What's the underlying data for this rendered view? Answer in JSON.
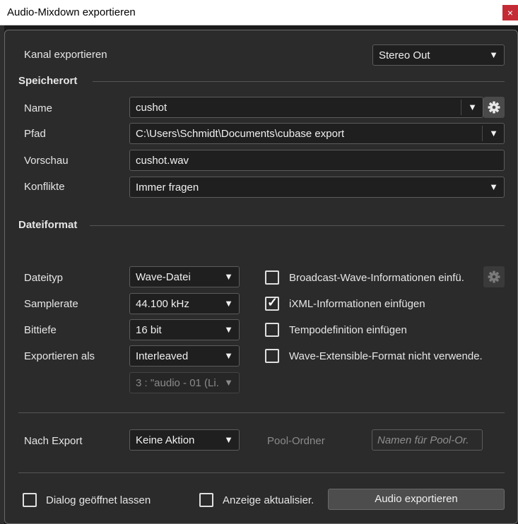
{
  "window": {
    "title": "Audio-Mixdown exportieren",
    "close_glyph": "×"
  },
  "channel": {
    "label": "Kanal exportieren",
    "value": "Stereo Out"
  },
  "location": {
    "section": "Speicherort",
    "name_label": "Name",
    "name_value": "cushot",
    "path_label": "Pfad",
    "path_value": "C:\\Users\\Schmidt\\Documents\\cubase export",
    "preview_label": "Vorschau",
    "preview_value": "cushot.wav",
    "conflicts_label": "Konflikte",
    "conflicts_value": "Immer fragen"
  },
  "format": {
    "section": "Dateiformat",
    "filetype_label": "Dateityp",
    "filetype_value": "Wave-Datei",
    "samplerate_label": "Samplerate",
    "samplerate_value": "44.100 kHz",
    "bitdepth_label": "Bittiefe",
    "bitdepth_value": "16 bit",
    "exportas_label": "Exportieren als",
    "exportas_value": "Interleaved",
    "track_value": "3 : \"audio - 01 (Li.",
    "options": [
      {
        "label": "Broadcast-Wave-Informationen einfü.",
        "checked": false
      },
      {
        "label": "iXML-Informationen einfügen",
        "checked": true
      },
      {
        "label": "Tempodefinition einfügen",
        "checked": false
      },
      {
        "label": "Wave-Extensible-Format nicht verwende.",
        "checked": false
      }
    ]
  },
  "after_export": {
    "label": "Nach Export",
    "value": "Keine Aktion",
    "pool_label": "Pool-Ordner",
    "pool_placeholder": "Namen für Pool-Or."
  },
  "footer": {
    "keep_open_label": "Dialog geöffnet lassen",
    "keep_open_checked": false,
    "update_label": "Anzeige aktualisier.",
    "update_checked": false,
    "export_button": "Audio exportieren"
  },
  "icons": {
    "dropdown": "▼",
    "check": "✓",
    "gear": "gear-icon"
  },
  "colors": {
    "panel": "#2b2b2b",
    "field": "#1f1f1f",
    "close": "#c42b35"
  }
}
